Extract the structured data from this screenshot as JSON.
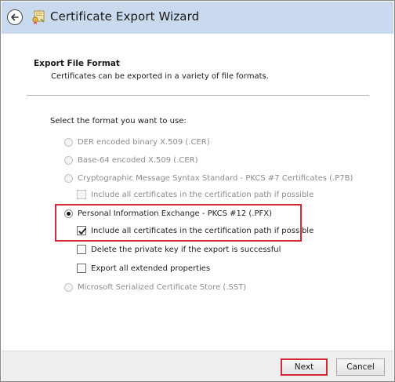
{
  "window": {
    "title": "Certificate Export Wizard",
    "back_icon": "back-arrow-icon",
    "app_icon": "certificate-icon"
  },
  "header": {
    "title": "Export File Format",
    "description": "Certificates can be exported in a variety of file formats."
  },
  "form": {
    "prompt": "Select the format you want to use:",
    "options": [
      {
        "label": "DER encoded binary X.509 (.CER)",
        "selected": false,
        "enabled": false
      },
      {
        "label": "Base-64 encoded X.509 (.CER)",
        "selected": false,
        "enabled": false
      },
      {
        "label": "Cryptographic Message Syntax Standard - PKCS #7 Certificates (.P7B)",
        "selected": false,
        "enabled": false
      },
      {
        "label": "Personal Information Exchange - PKCS #12 (.PFX)",
        "selected": true,
        "enabled": true
      },
      {
        "label": "Microsoft Serialized Certificate Store (.SST)",
        "selected": false,
        "enabled": false
      }
    ],
    "pkcs7_include_all": {
      "label": "Include all certificates in the certification path if possible",
      "checked": false,
      "enabled": false
    },
    "pfx_include_all": {
      "label": "Include all certificates in the certification path if possible",
      "checked": true,
      "enabled": true
    },
    "delete_private_key": {
      "label": "Delete the private key if the export is successful",
      "checked": false,
      "enabled": true
    },
    "export_extended": {
      "label": "Export all extended properties",
      "checked": false,
      "enabled": true
    }
  },
  "footer": {
    "next_label": "Next",
    "cancel_label": "Cancel"
  },
  "colors": {
    "titlebar": "#c9d9ee",
    "highlight": "#d42a35",
    "footer": "#efefef"
  }
}
